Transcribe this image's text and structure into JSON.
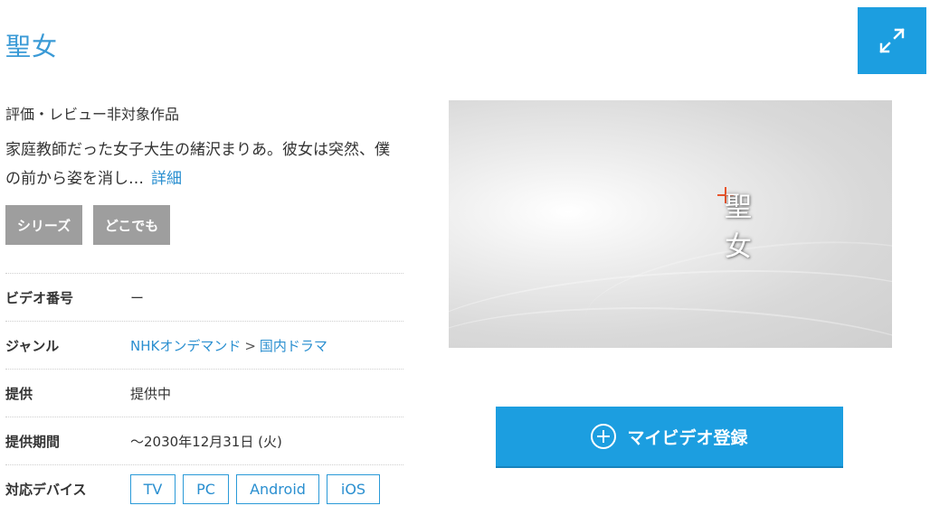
{
  "title": "聖女",
  "rating_note": "評価・レビュー非対象作品",
  "synopsis": "家庭教師だった女子大生の緒沢まりあ。彼女は突然、僕の前から姿を消し…",
  "synopsis_more": "詳細",
  "tags": [
    "シリーズ",
    "どこでも"
  ],
  "info": {
    "video_no": {
      "label": "ビデオ番号",
      "value": "ー"
    },
    "genre": {
      "label": "ジャンル",
      "link1": "NHKオンデマンド",
      "sep": ">",
      "link2": "国内ドラマ"
    },
    "status": {
      "label": "提供",
      "value": "提供中"
    },
    "period": {
      "label": "提供期間",
      "value": "～2030年12月31日 (火)"
    },
    "devices": {
      "label": "対応デバイス",
      "items": [
        "TV",
        "PC",
        "Android",
        "iOS"
      ]
    }
  },
  "thumbnail": {
    "overlay_text_1": "聖",
    "overlay_text_2": "女"
  },
  "mylist_button": "マイビデオ登録",
  "icons": {
    "expand": "expand-arrows-icon",
    "add": "plus-circle-icon"
  },
  "colors": {
    "accent": "#1c9ee0",
    "link": "#2a8fd0",
    "tag_bg": "#9e9e9e"
  }
}
